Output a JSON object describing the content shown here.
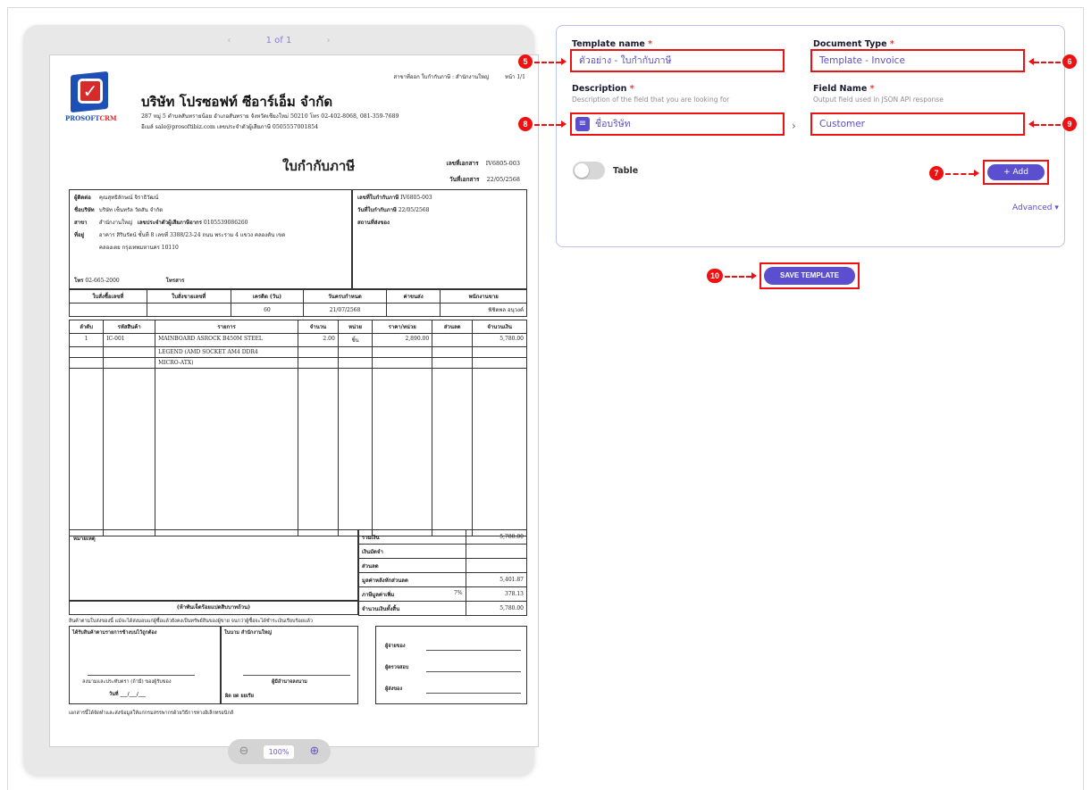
{
  "viewer": {
    "pager": {
      "prev": "‹",
      "current": "1 of 1",
      "next": "›"
    },
    "zoom": {
      "out_icon": "zoom-out-icon",
      "value": "100%",
      "in_icon": "zoom-in-icon"
    }
  },
  "document": {
    "header_branch": "สาขาที่ออก ใบกำกับภาษี : สำนักงานใหญ่",
    "header_page": "หน้า 1/1",
    "logo_text_a": "PROSOFT",
    "logo_text_b": "CRM",
    "company_name": "บริษัท โปรซอฟท์ ซีอาร์เอ็ม จำกัด",
    "company_address": "287 หมู่ 5 ตำบลสันทรายน้อย อำเภอสันทราย จังหวัดเชียงใหม่ 50210 โทร 02-402-8068, 081-359-7689",
    "company_contact": "อีเมล์ sale@prosoftibiz.com เลขประจำตัวผู้เสียภาษี 0505557001854",
    "title": "ใบกำกับภาษี",
    "doc_no_label": "เลขที่เอกสาร",
    "doc_no": "IV6805-003",
    "doc_date_label": "วันที่เอกสาร",
    "doc_date": "22/05/2568",
    "customer": {
      "contact_label": "ผู้ติดต่อ",
      "contact": "คุณสุทธิลักษณ์ จิราธิวัฒน์",
      "company_label": "ชื่อบริษัท",
      "company": "บริษัท เซ็นทรัล วัตสัน จำกัด",
      "branch_label": "สาขา",
      "branch": "สำนักงานใหญ่",
      "taxid_label": "เลขประจำตัวผู้เสียภาษีอากร",
      "taxid": "0105539086260",
      "address_label": "ที่อยู่",
      "address1": "อาคาร สิรินรัตน์ ชั้นที่ 8 เลขที่ 3388/23-24 ถนน พระราม 4 แขวง คลองตัน เขต",
      "address2": "คลองเตย กรุงเทพมหานคร 10110",
      "phone_label": "โทร",
      "phone": "02-665-2000",
      "fax_label": "โทรสาร"
    },
    "invoice_ref": {
      "invoice_no_label": "เลขที่ใบกำกับภาษี",
      "invoice_no": "IV6805-003",
      "invoice_date_label": "วันที่ใบกำกับภาษี",
      "invoice_date": "22/05/2568",
      "ship_label": "สถานที่ส่งของ"
    },
    "terms": {
      "headers": [
        "ใบสั่งซื้อเลขที่",
        "ใบสั่งขายเลขที่",
        "เครดิต (วัน)",
        "วันครบกำหนด",
        "ค่าขนส่ง",
        "พนักงานขาย"
      ],
      "values": [
        "",
        "",
        "60",
        "21/07/2568",
        "",
        "พิชิตพล อนุวงค์"
      ]
    },
    "items": {
      "headers": [
        "ลำดับ",
        "รหัสสินค้า",
        "รายการ",
        "จำนวน",
        "หน่วย",
        "ราคา/หน่วย",
        "ส่วนลด",
        "จำนวนเงิน"
      ],
      "rows": [
        [
          "1",
          "IC-001",
          "MAINBOARD ASROCK B450M STEEL",
          "2.00",
          "ชิ้น",
          "2,890.00",
          "",
          "5,780.00"
        ],
        [
          "",
          "",
          "LEGEND (AMD SOCKET AM4 DDR4",
          "",
          "",
          "",
          "",
          ""
        ],
        [
          "",
          "",
          "MICRO-ATX)",
          "",
          "",
          "",
          "",
          ""
        ]
      ]
    },
    "remark_label": "หมายเหตุ",
    "amount_words": "(ห้าพันเจ็ดร้อยแปดสิบบาทถ้วน)",
    "summary": [
      {
        "label": "รวมเงิน",
        "rate": "",
        "value": "5,780.00"
      },
      {
        "label": "เงินมัดจำ",
        "rate": "",
        "value": ""
      },
      {
        "label": "ส่วนลด",
        "rate": "",
        "value": ""
      },
      {
        "label": "มูลค่าหลังหักส่วนลด",
        "rate": "",
        "value": "5,401.87"
      },
      {
        "label": "ภาษีมูลค่าเพิ่ม",
        "rate": "7%",
        "value": "378.13"
      },
      {
        "label": "จำนวนเงินทั้งสิ้น",
        "rate": "",
        "value": "5,780.00"
      }
    ],
    "legal_note": "สินค้าตามใบส่งของนี้ แม้จะได้ส่งมอบแก่ผู้ซื้อแล้วยังคงเป็นทรัพย์สินของผู้ขาย จนกว่าผู้ซื้อจะได้ชำระเงินเรียบร้อยแล้ว",
    "sign": {
      "received_label": "ได้รับสินค้าตามรายการข้างบนไว้ถูกต้อง",
      "received_sign": "ลงนามและประทับตรา (ถ้ามี) ของผู้รับของ",
      "received_date": "วันที่ ___/___/___",
      "payment_label": "ในนาม สำนักงานใหญ่",
      "authorized": "ผู้มีอำนาจลงนาม",
      "cashier": "ผิด ยด ยยเรีย",
      "payer_label": "ผู้จ่ายของ",
      "checker_label": "ผู้ตรวจสอบ",
      "deliver_label": "ผู้ส่งของ"
    },
    "footer": "เอกสารนี้ได้จัดทำและส่งข้อมูลให้แก่กรมสรรพากรด้วยวิธีการทางอิเล็กทรอนิกส์"
  },
  "form": {
    "template_name_label": "Template name",
    "template_name_value": "ตัวอย่าง - ใบกำกับภาษี",
    "doc_type_label": "Document Type",
    "doc_type_value": "Template - Invoice",
    "description_label": "Description",
    "description_hint": "Description of the field that you are looking for",
    "description_value": "ชื่อบริษัท",
    "field_name_label": "Field Name",
    "field_name_hint": "Output field used in JSON API response",
    "field_name_value": "Customer",
    "arrow": "›",
    "required_mark": "*",
    "table_label": "Table",
    "add_label": "+ Add",
    "advanced_label": "Advanced ▾"
  },
  "save_label": "SAVE TEMPLATE",
  "callouts": [
    "5",
    "6",
    "8",
    "9",
    "7",
    "10"
  ]
}
